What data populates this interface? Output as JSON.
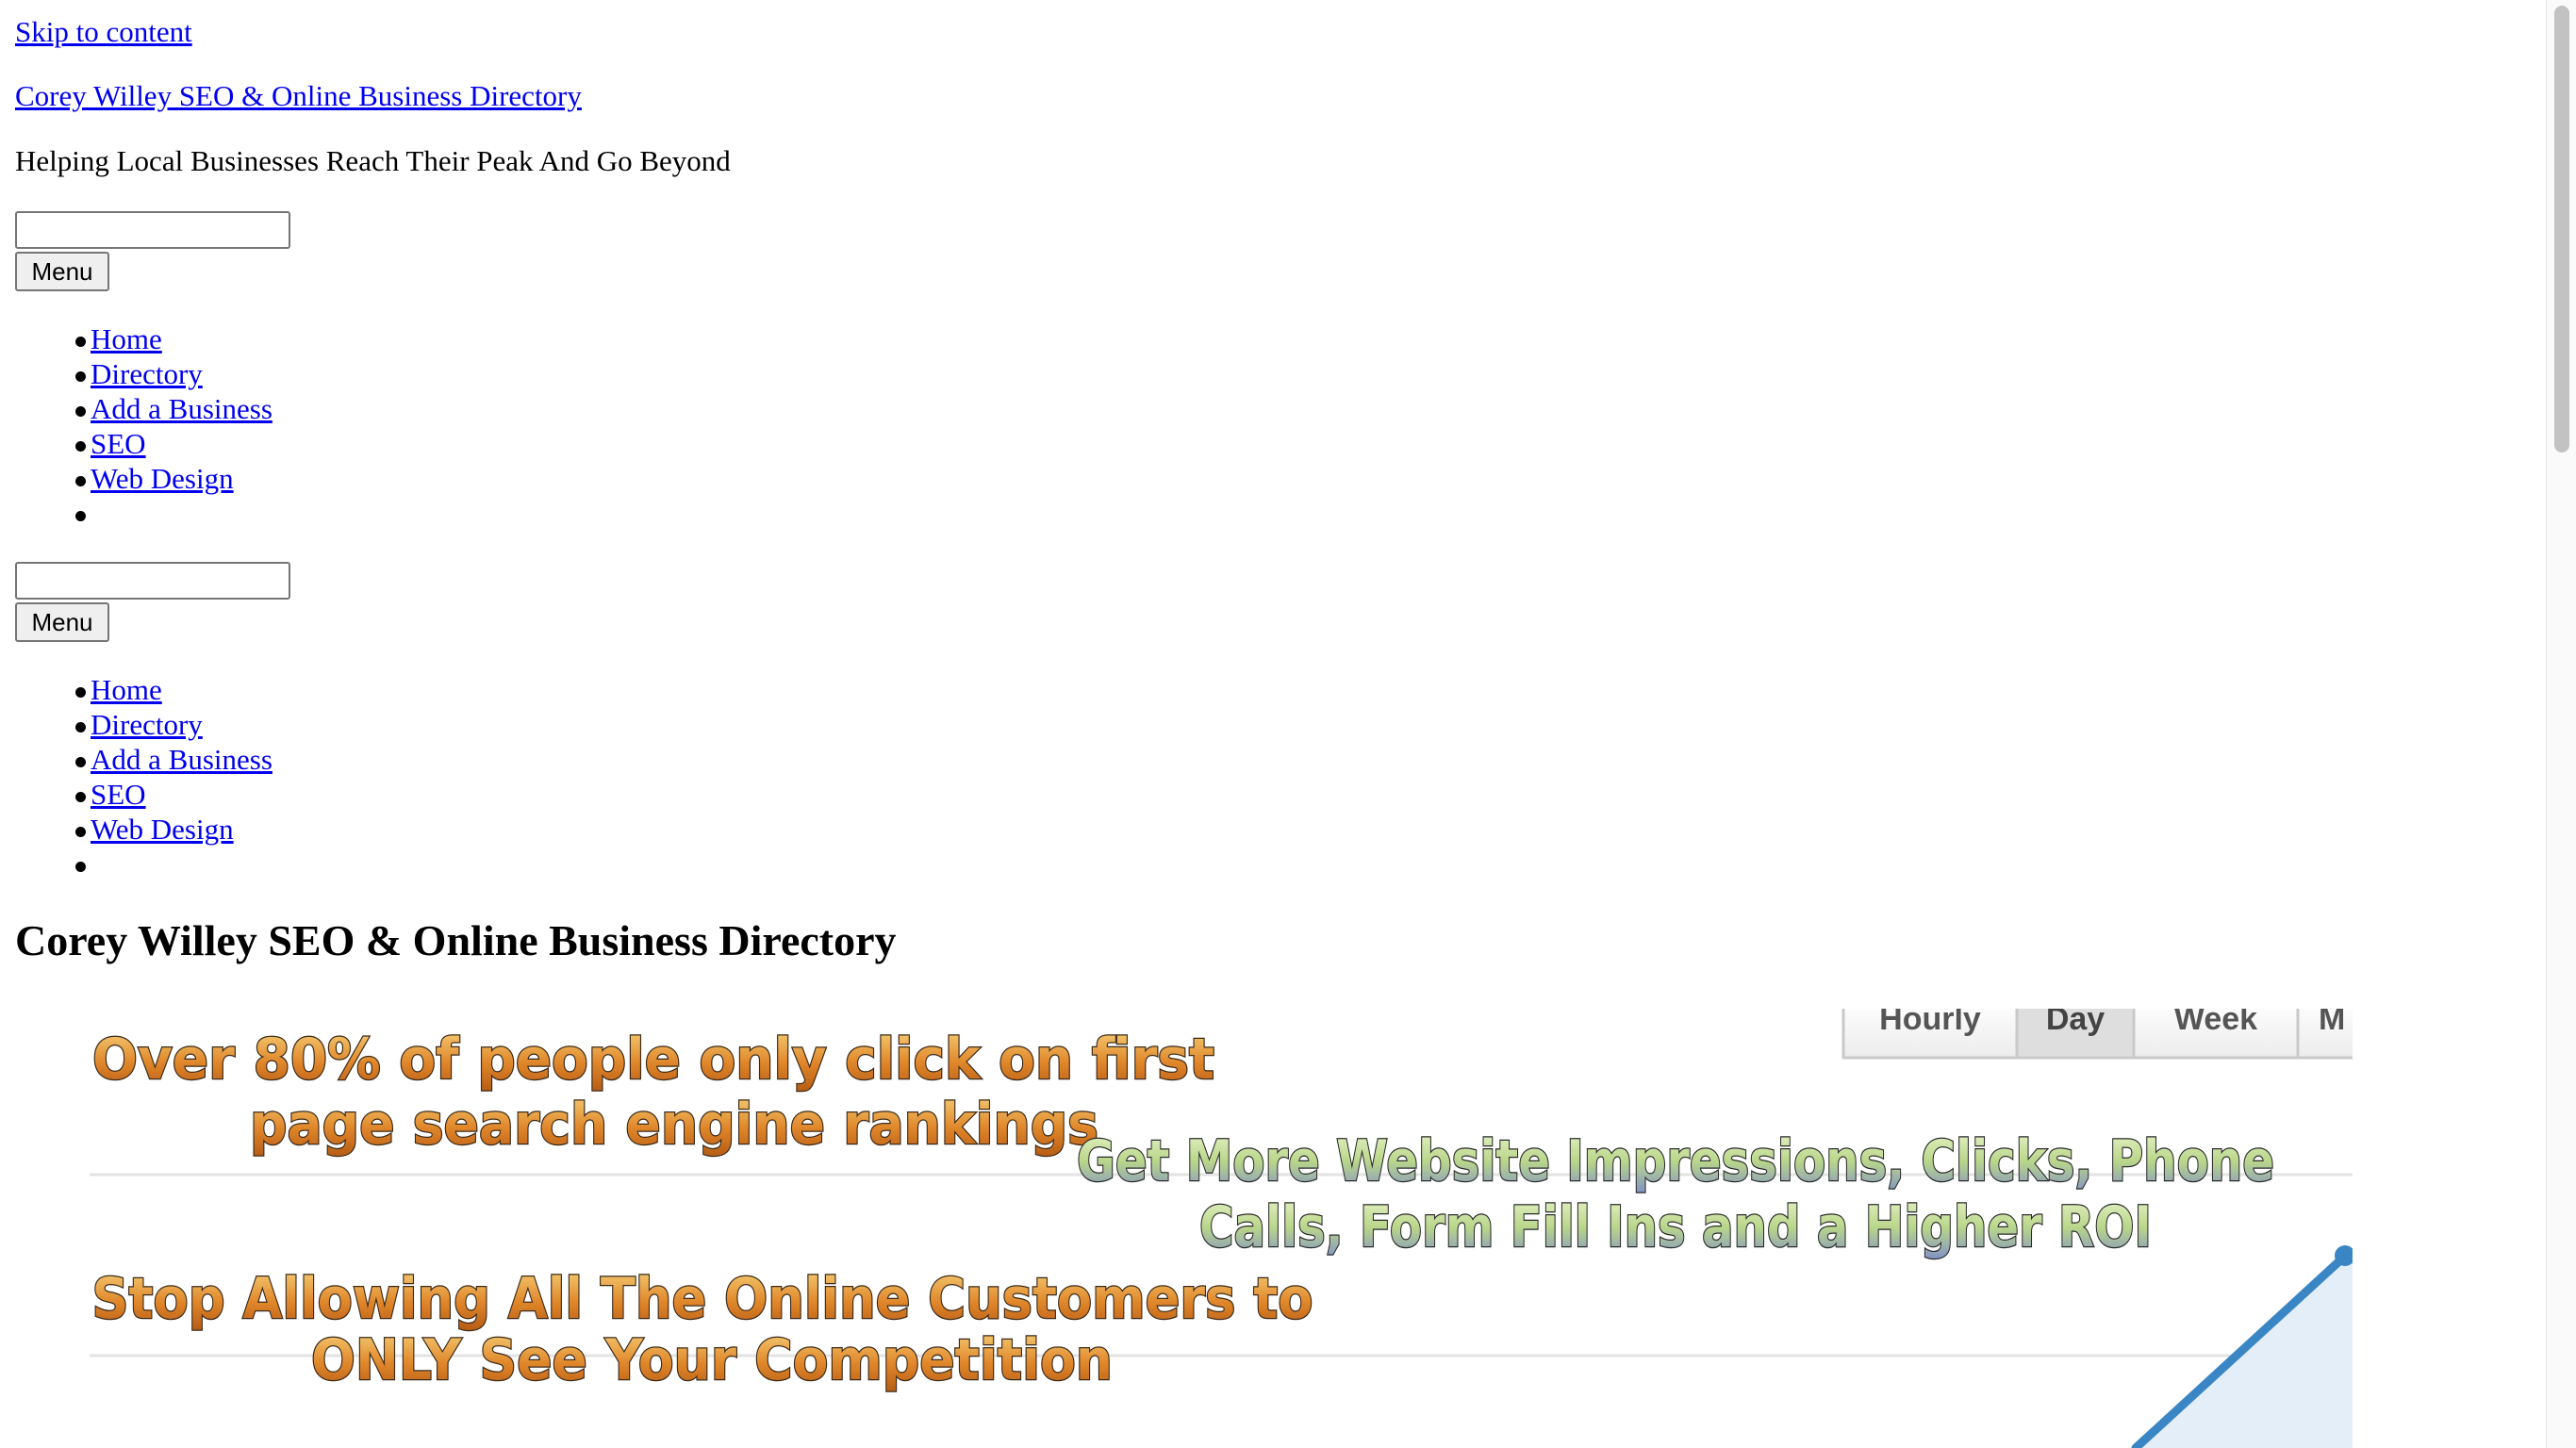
{
  "skip_link": "Skip to content",
  "site": {
    "title_link": "Corey Willey SEO & Online Business Directory",
    "tagline": "Helping Local Businesses Reach Their Peak And Go Beyond"
  },
  "search": {
    "value": ""
  },
  "menu_button": "Menu",
  "nav_items": [
    "Home",
    "Directory",
    "Add a Business",
    "SEO",
    "Web Design",
    ""
  ],
  "page_title": "Corey Willey SEO & Online Business Directory",
  "banner": {
    "tabs": [
      "Hourly",
      "Day",
      "Week",
      "M"
    ],
    "headline_1_line_1": "Over 80% of people only click on first",
    "headline_1_line_2": "page search engine rankings",
    "headline_2_line_1": "Get More Website Impressions, Clicks, Phone",
    "headline_2_line_2": "Calls, Form Fill Ins and a Higher ROI",
    "headline_3_line_1": "Stop Allowing All The Online Customers to",
    "headline_3_line_2": "ONLY See Your Competition"
  },
  "colors": {
    "link": "#0000ee",
    "banner_orange_text": "#e0862a",
    "banner_green_text": "#b9d68a",
    "chart_line": "#3a86c4",
    "chart_fill": "#e3eef8"
  }
}
